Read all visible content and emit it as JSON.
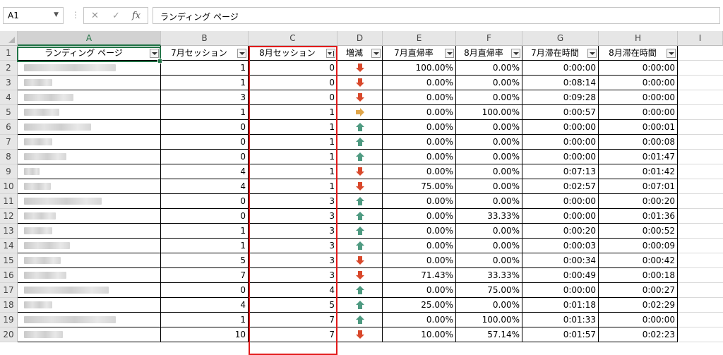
{
  "formula_bar": {
    "name_box": "A1",
    "cancel_icon": "✕",
    "enter_icon": "✓",
    "fx_icon": "fx",
    "content": "ランディング ページ"
  },
  "columns": [
    "A",
    "B",
    "C",
    "D",
    "E",
    "F",
    "G",
    "H",
    "I"
  ],
  "header_row": {
    "row_number": "1",
    "cells": [
      "ランディング ページ",
      "7月セッション",
      "8月セッション",
      "増減",
      "7月直帰率",
      "8月直帰率",
      "7月滞在時間",
      "8月滞在時間"
    ]
  },
  "rows": [
    {
      "n": "2",
      "b": "1",
      "c": "0",
      "d": "down",
      "e": "100.00%",
      "f": "0.00%",
      "g": "0:00:00",
      "h": "0:00:00"
    },
    {
      "n": "3",
      "b": "1",
      "c": "0",
      "d": "down",
      "e": "0.00%",
      "f": "0.00%",
      "g": "0:08:14",
      "h": "0:00:00"
    },
    {
      "n": "4",
      "b": "3",
      "c": "0",
      "d": "down",
      "e": "0.00%",
      "f": "0.00%",
      "g": "0:09:28",
      "h": "0:00:00"
    },
    {
      "n": "5",
      "b": "1",
      "c": "1",
      "d": "flat",
      "e": "0.00%",
      "f": "100.00%",
      "g": "0:00:57",
      "h": "0:00:00"
    },
    {
      "n": "6",
      "b": "0",
      "c": "1",
      "d": "up",
      "e": "0.00%",
      "f": "0.00%",
      "g": "0:00:00",
      "h": "0:00:01"
    },
    {
      "n": "7",
      "b": "0",
      "c": "1",
      "d": "up",
      "e": "0.00%",
      "f": "0.00%",
      "g": "0:00:00",
      "h": "0:00:08"
    },
    {
      "n": "8",
      "b": "0",
      "c": "1",
      "d": "up",
      "e": "0.00%",
      "f": "0.00%",
      "g": "0:00:00",
      "h": "0:01:47"
    },
    {
      "n": "9",
      "b": "4",
      "c": "1",
      "d": "down",
      "e": "0.00%",
      "f": "0.00%",
      "g": "0:07:13",
      "h": "0:01:42"
    },
    {
      "n": "10",
      "b": "4",
      "c": "1",
      "d": "down",
      "e": "75.00%",
      "f": "0.00%",
      "g": "0:02:57",
      "h": "0:07:01"
    },
    {
      "n": "11",
      "b": "0",
      "c": "3",
      "d": "up",
      "e": "0.00%",
      "f": "0.00%",
      "g": "0:00:00",
      "h": "0:00:20"
    },
    {
      "n": "12",
      "b": "0",
      "c": "3",
      "d": "up",
      "e": "0.00%",
      "f": "33.33%",
      "g": "0:00:00",
      "h": "0:01:36"
    },
    {
      "n": "13",
      "b": "1",
      "c": "3",
      "d": "up",
      "e": "0.00%",
      "f": "0.00%",
      "g": "0:00:20",
      "h": "0:00:52"
    },
    {
      "n": "14",
      "b": "1",
      "c": "3",
      "d": "up",
      "e": "0.00%",
      "f": "0.00%",
      "g": "0:00:03",
      "h": "0:00:09"
    },
    {
      "n": "15",
      "b": "5",
      "c": "3",
      "d": "down",
      "e": "0.00%",
      "f": "0.00%",
      "g": "0:00:34",
      "h": "0:00:42"
    },
    {
      "n": "16",
      "b": "7",
      "c": "3",
      "d": "down",
      "e": "71.43%",
      "f": "33.33%",
      "g": "0:00:49",
      "h": "0:00:18"
    },
    {
      "n": "17",
      "b": "0",
      "c": "4",
      "d": "up",
      "e": "0.00%",
      "f": "75.00%",
      "g": "0:00:00",
      "h": "0:00:27"
    },
    {
      "n": "18",
      "b": "4",
      "c": "5",
      "d": "up",
      "e": "25.00%",
      "f": "0.00%",
      "g": "0:01:18",
      "h": "0:02:29"
    },
    {
      "n": "19",
      "b": "1",
      "c": "7",
      "d": "up",
      "e": "0.00%",
      "f": "100.00%",
      "g": "0:01:33",
      "h": "0:00:00"
    },
    {
      "n": "20",
      "b": "10",
      "c": "7",
      "d": "down",
      "e": "10.00%",
      "f": "57.14%",
      "g": "0:01:57",
      "h": "0:02:23"
    }
  ],
  "colors": {
    "down": "#d9482b",
    "up": "#4e9a81",
    "flat": "#e0a64a",
    "highlight": "#e21a1a",
    "selection": "#217346"
  }
}
